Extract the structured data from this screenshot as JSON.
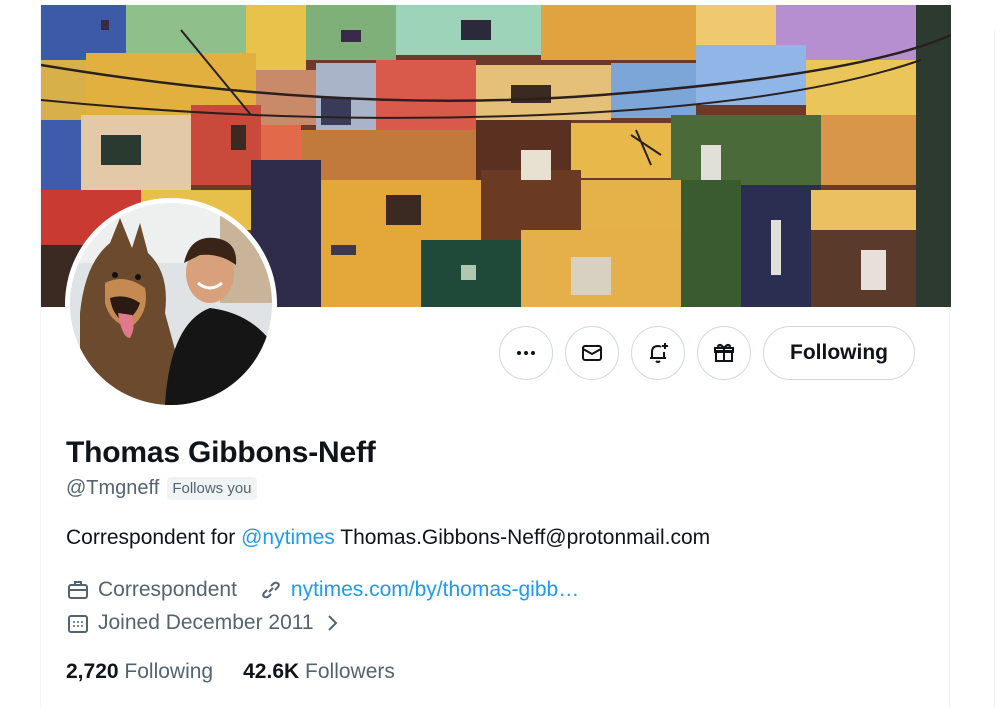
{
  "profile": {
    "display_name": "Thomas Gibbons-Neff",
    "handle": "@Tmgneff",
    "follows_you": "Follows you",
    "bio_prefix": "Correspondent for ",
    "bio_mention": "@nytimes",
    "bio_suffix": " Thomas.Gibbons-Neff@protonmail.com",
    "profession": "Correspondent",
    "website": "nytimes.com/by/thomas-gibb…",
    "joined": "Joined December 2011",
    "following_count": "2,720",
    "following_label": "Following",
    "followers_count": "42.6K",
    "followers_label": "Followers"
  },
  "actions": {
    "follow_label": "Following",
    "more_icon": "more-icon",
    "message_icon": "envelope-icon",
    "notify_icon": "bell-plus-icon",
    "subscribe_icon": "gift-icon"
  },
  "colors": {
    "accent": "#1d9bf0",
    "text": "#0f1419",
    "secondary": "#536471",
    "border": "#cfd9de"
  }
}
